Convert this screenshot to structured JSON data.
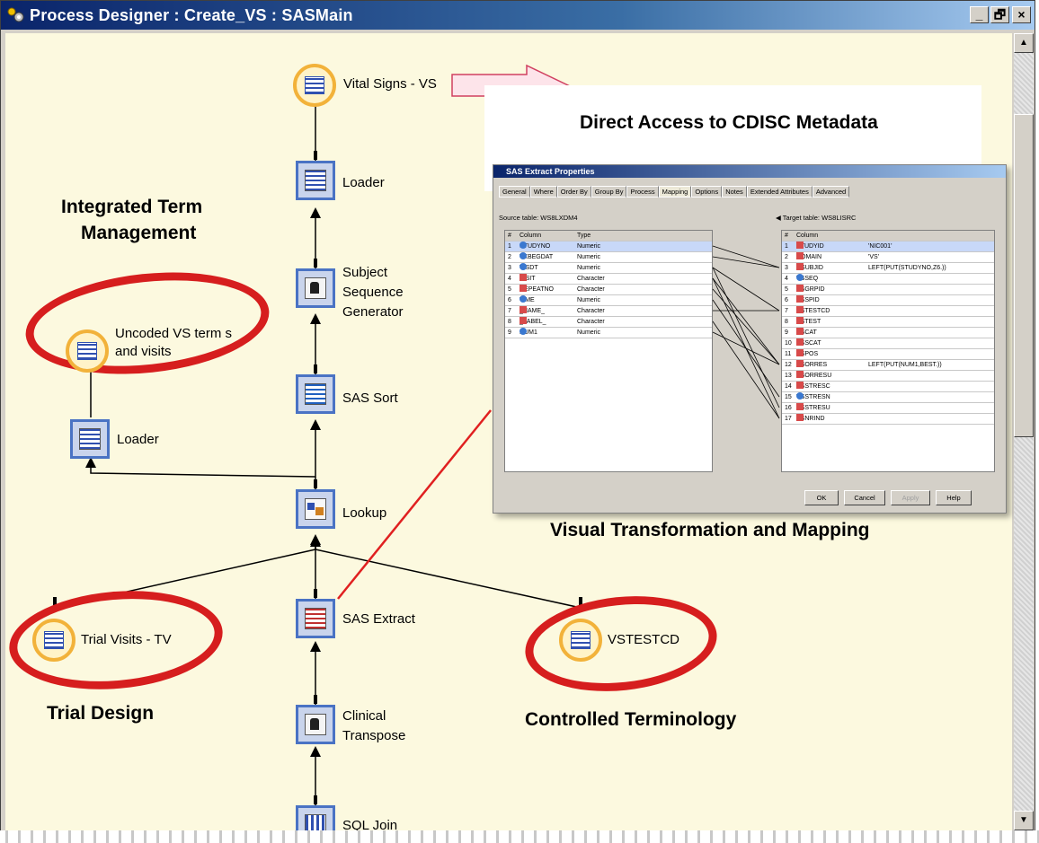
{
  "window": {
    "title": "Process Designer : Create_VS : SASMain",
    "controls": [
      "_",
      "🗗",
      "×"
    ]
  },
  "nodes": {
    "vital_signs": "Vital Signs - VS",
    "loader_top": "Loader",
    "subject_seq": [
      "Subject",
      "Sequence",
      "Generator"
    ],
    "sas_sort": "SAS Sort",
    "lookup": "Lookup",
    "sas_extract": "SAS Extract",
    "clinical_transpose": [
      "Clinical",
      "Transpose"
    ],
    "sql_join": "SQL Join",
    "uncoded": [
      "Uncoded VS term s",
      "and visits"
    ],
    "loader_left": "Loader",
    "trial_visits": "Trial Visits - TV",
    "vstestcd": "VSTESTCD"
  },
  "annotations": {
    "integrated": [
      "Integrated Term",
      "Management"
    ],
    "direct_access": "Direct Access to CDISC Metadata",
    "visual_transformation": "Visual Transformation and Mapping",
    "trial_design": "Trial Design",
    "controlled_terminology": "Controlled Terminology"
  },
  "colors": {
    "canvas": "#fcf9df",
    "node_border": "#4a73c4",
    "circle_border": "#f2b23a",
    "red_loop": "#d61e1e"
  },
  "dialog": {
    "title": "SAS Extract Properties",
    "tabs": [
      "General",
      "Where",
      "Order By",
      "Group By",
      "Process",
      "Mapping",
      "Options",
      "Notes",
      "Extended Attributes",
      "Advanced"
    ],
    "source_label": "Source table: WS8LXDM4",
    "target_label": "Target table: WS8LISRC",
    "source_headers": [
      "#",
      "Column",
      "Type"
    ],
    "target_headers": [
      "#",
      "Column",
      ""
    ],
    "source_rows": [
      [
        "1",
        "STUDYNO",
        "Numeric",
        "num"
      ],
      [
        "2",
        "TXBEGDAT",
        "Numeric",
        "num"
      ],
      [
        "3",
        "VISDT",
        "Numeric",
        "num"
      ],
      [
        "4",
        "VISIT",
        "Character",
        "char"
      ],
      [
        "5",
        "REPEATNO",
        "Character",
        "char"
      ],
      [
        "6",
        "TIME",
        "Numeric",
        "num"
      ],
      [
        "7",
        "_NAME_",
        "Character",
        "char"
      ],
      [
        "8",
        "_LABEL_",
        "Character",
        "char"
      ],
      [
        "9",
        "NUM1",
        "Numeric",
        "num"
      ]
    ],
    "target_rows": [
      [
        "1",
        "STUDYID",
        "'NIC001'",
        "char"
      ],
      [
        "2",
        "DOMAIN",
        "'VS'",
        "char"
      ],
      [
        "3",
        "USUBJID",
        "LEFT(PUT(STUDYNO,Z6.))",
        "char"
      ],
      [
        "4",
        "VSSEQ",
        "",
        "num"
      ],
      [
        "5",
        "VSGRPID",
        "",
        "char"
      ],
      [
        "6",
        "VSSPID",
        "",
        "char"
      ],
      [
        "7",
        "VSTESTCD",
        "",
        "char"
      ],
      [
        "8",
        "VSTEST",
        "",
        "char"
      ],
      [
        "9",
        "VSCAT",
        "",
        "char"
      ],
      [
        "10",
        "VSSCAT",
        "",
        "char"
      ],
      [
        "11",
        "VSPOS",
        "",
        "char"
      ],
      [
        "12",
        "VSORRES",
        "LEFT(PUT(NUM1,BEST.))",
        "char"
      ],
      [
        "13",
        "VSORRESU",
        "",
        "char"
      ],
      [
        "14",
        "VSSTRESC",
        "",
        "char"
      ],
      [
        "15",
        "VSSTRESN",
        "",
        "num"
      ],
      [
        "16",
        "VSSTRESU",
        "",
        "char"
      ],
      [
        "17",
        "VSNRIND",
        "",
        "char"
      ]
    ],
    "buttons": [
      "OK",
      "Cancel",
      "Apply",
      "Help"
    ]
  }
}
